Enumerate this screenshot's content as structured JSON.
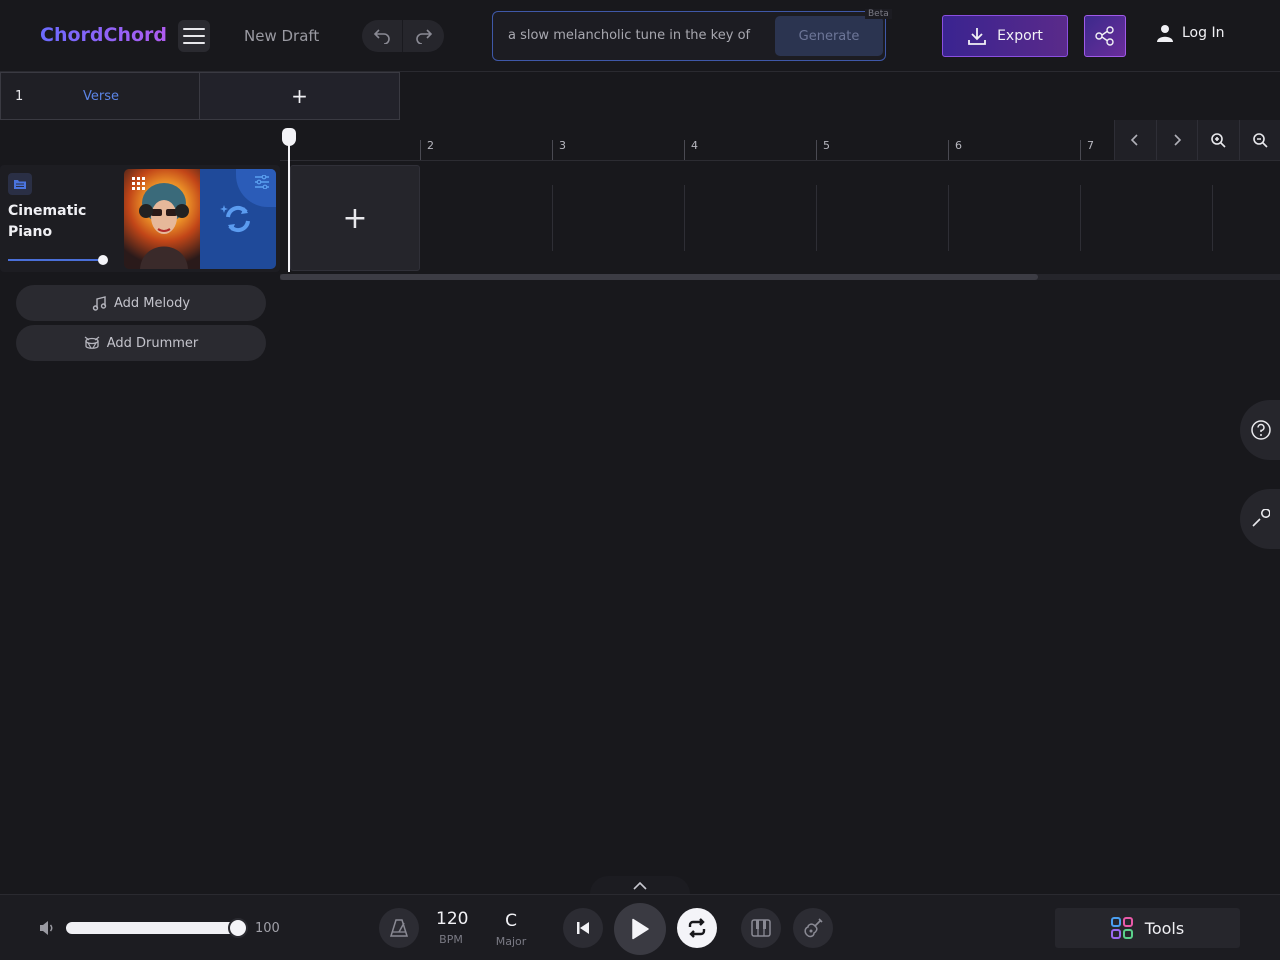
{
  "header": {
    "logo": "ChordChord",
    "draft_name": "New Draft",
    "prompt_text": "a slow melancholic tune in the key of",
    "generate_label": "Generate",
    "beta_label": "Beta",
    "export_label": "Export",
    "login_label": "Log In"
  },
  "sections": {
    "items": [
      {
        "number": "1",
        "label": "Verse"
      }
    ],
    "add_label": "+"
  },
  "timeline": {
    "bars": [
      "2",
      "3",
      "4",
      "5",
      "6",
      "7"
    ]
  },
  "track": {
    "name": "Cinematic Piano",
    "volume": 0.95,
    "add_block_label": "+"
  },
  "actions": {
    "add_melody": "Add Melody",
    "add_drummer": "Add Drummer"
  },
  "transport": {
    "volume_value": "100",
    "tempo_value": "120",
    "tempo_unit": "BPM",
    "key_value": "C",
    "key_mode": "Major",
    "tools_label": "Tools"
  },
  "colors": {
    "accent": "#5b84e6",
    "brand": "#8a5cf6",
    "background": "#18181c"
  },
  "icons": [
    "menu-icon",
    "undo-icon",
    "redo-icon",
    "download-icon",
    "share-icon",
    "user-icon",
    "folder-icon",
    "grid-icon",
    "refresh-icon",
    "sliders-icon",
    "chevron-left-icon",
    "chevron-right-icon",
    "zoom-in-icon",
    "zoom-out-icon",
    "music-note-icon",
    "drum-icon",
    "help-icon",
    "wrench-icon",
    "chevron-up-icon",
    "speaker-icon",
    "metronome-icon",
    "skip-back-icon",
    "play-icon",
    "loop-icon",
    "piano-icon",
    "guitar-icon",
    "tools-grid-icon"
  ]
}
